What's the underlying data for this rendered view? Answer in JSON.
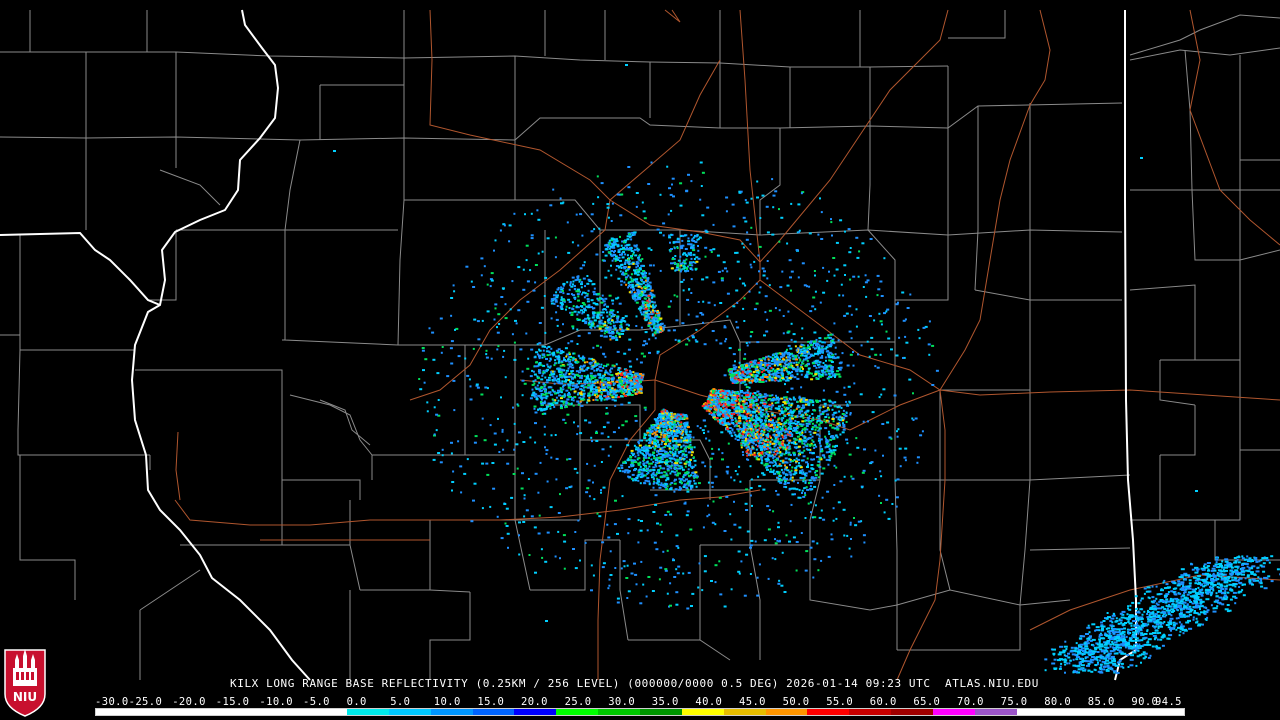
{
  "product": {
    "caption": "KILX LONG RANGE BASE REFLECTIVITY (0.25KM / 256 LEVEL) (000000/0000 0.5 DEG) 2026-01-14 09:23 UTC  ATLAS.NIU.EDU"
  },
  "logo": {
    "text": "NIU",
    "colors": {
      "shield": "#c8102e",
      "building": "#ffffff",
      "outline": "#ffffff"
    }
  },
  "legend": {
    "labels": [
      "-30.0",
      "-25.0",
      "-20.0",
      "-15.0",
      "-10.0",
      "-5.0",
      "0.0",
      "5.0",
      "10.0",
      "15.0",
      "20.0",
      "25.0",
      "30.0",
      "35.0",
      "40.0",
      "45.0",
      "50.0",
      "55.0",
      "60.0",
      "65.0",
      "70.0",
      "75.0",
      "80.0",
      "85.0",
      "90.0",
      "94.5"
    ],
    "colors": [
      "#ffffff",
      "#ffffff",
      "#ffffff",
      "#ffffff",
      "#ffffff",
      "#ffffff",
      "#00eaea",
      "#00c8ff",
      "#0096ff",
      "#0064ff",
      "#0000ff",
      "#00ff00",
      "#00c800",
      "#009600",
      "#ffff00",
      "#e6be00",
      "#ff9600",
      "#ff0000",
      "#c80000",
      "#a00000",
      "#ff00ff",
      "#9b55c8",
      "#ffffff",
      "#ffffff",
      "#ffffff",
      "#ffffff"
    ]
  },
  "map_style": {
    "background": "#000000",
    "county_line_color": "#8a8a8a",
    "state_line_color": "#ffffff",
    "highway_color": "#b0562e"
  },
  "echo_colors": {
    "weak": "#1e90ff",
    "light": "#00d0ff",
    "moderate": "#00e05a",
    "strong": "#f0e000",
    "heavy": "#ff8c00",
    "intense": "#ff2020"
  }
}
